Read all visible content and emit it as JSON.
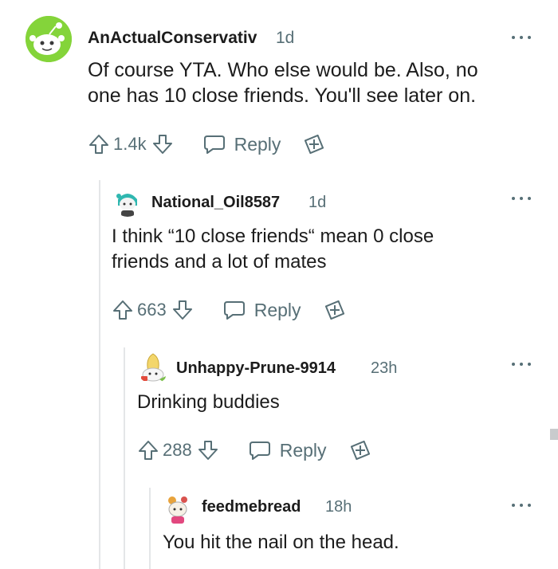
{
  "comments": [
    {
      "username": "AnActualConservativ",
      "time": "1d",
      "body_lines": [
        "Of course YTA. Who else would be. Also, no",
        "one has 10 close friends. You'll see later on."
      ],
      "votes": "1.4k",
      "reply_label": "Reply"
    },
    {
      "username": "National_Oil8587",
      "time": "1d",
      "body_lines": [
        "I think “10 close friends“ mean 0 close",
        "friends and a lot of mates"
      ],
      "votes": "663",
      "reply_label": "Reply"
    },
    {
      "username": "Unhappy-Prune-9914",
      "time": "23h",
      "body_lines": [
        "Drinking buddies"
      ],
      "votes": "288",
      "reply_label": "Reply"
    },
    {
      "username": "feedmebread",
      "time": "18h",
      "body_lines": [
        "You hit the nail on the head."
      ]
    }
  ],
  "colors": {
    "meta_gray": "#576f76",
    "text": "#1c1c1c",
    "thread_line": "#e4e6e8"
  },
  "icons": [
    "upvote-icon",
    "downvote-icon",
    "reply-icon",
    "award-icon",
    "more-options-icon"
  ]
}
